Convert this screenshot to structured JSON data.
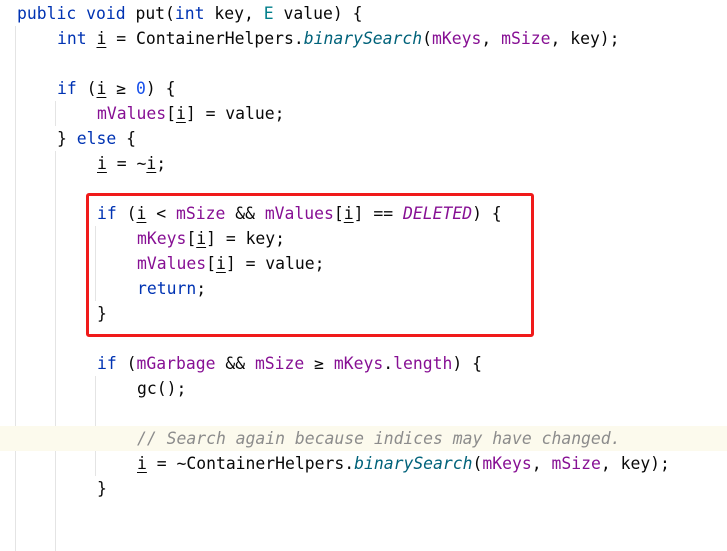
{
  "editor": {
    "language": "Java",
    "lines": [
      {
        "indent": 0,
        "tokens": [
          {
            "t": "public",
            "c": "kw"
          },
          {
            "t": " "
          },
          {
            "t": "void",
            "c": "kw"
          },
          {
            "t": " put("
          },
          {
            "t": "int",
            "c": "kw"
          },
          {
            "t": " key, "
          },
          {
            "t": "E",
            "c": "type-param"
          },
          {
            "t": " value) {"
          }
        ]
      },
      {
        "indent": 1,
        "tokens": [
          {
            "t": "int",
            "c": "kw"
          },
          {
            "t": " "
          },
          {
            "t": "i",
            "c": "reassigned"
          },
          {
            "t": " = ContainerHelpers."
          },
          {
            "t": "binarySearch",
            "c": "static-method"
          },
          {
            "t": "("
          },
          {
            "t": "mKeys",
            "c": "field"
          },
          {
            "t": ", "
          },
          {
            "t": "mSize",
            "c": "field"
          },
          {
            "t": ", key);"
          }
        ]
      },
      {
        "indent": 0,
        "tokens": []
      },
      {
        "indent": 1,
        "tokens": [
          {
            "t": "if",
            "c": "kw"
          },
          {
            "t": " ("
          },
          {
            "t": "i",
            "c": "reassigned"
          },
          {
            "t": " ≥ "
          },
          {
            "t": "0",
            "c": "num"
          },
          {
            "t": ") {"
          }
        ]
      },
      {
        "indent": 2,
        "tokens": [
          {
            "t": "mValues",
            "c": "field"
          },
          {
            "t": "["
          },
          {
            "t": "i",
            "c": "reassigned"
          },
          {
            "t": "] = value;"
          }
        ]
      },
      {
        "indent": 1,
        "tokens": [
          {
            "t": "} "
          },
          {
            "t": "else",
            "c": "kw"
          },
          {
            "t": " {"
          }
        ]
      },
      {
        "indent": 2,
        "tokens": [
          {
            "t": "i",
            "c": "reassigned"
          },
          {
            "t": " = ~"
          },
          {
            "t": "i",
            "c": "reassigned"
          },
          {
            "t": ";"
          }
        ]
      },
      {
        "indent": 0,
        "tokens": []
      },
      {
        "indent": 2,
        "tokens": [
          {
            "t": "if",
            "c": "kw"
          },
          {
            "t": " ("
          },
          {
            "t": "i",
            "c": "reassigned"
          },
          {
            "t": " < "
          },
          {
            "t": "mSize",
            "c": "field"
          },
          {
            "t": " && "
          },
          {
            "t": "mValues",
            "c": "field"
          },
          {
            "t": "["
          },
          {
            "t": "i",
            "c": "reassigned"
          },
          {
            "t": "] == "
          },
          {
            "t": "DELETED",
            "c": "const"
          },
          {
            "t": ") {"
          }
        ]
      },
      {
        "indent": 3,
        "tokens": [
          {
            "t": "mKeys",
            "c": "field"
          },
          {
            "t": "["
          },
          {
            "t": "i",
            "c": "reassigned"
          },
          {
            "t": "] = key;"
          }
        ]
      },
      {
        "indent": 3,
        "tokens": [
          {
            "t": "mValues",
            "c": "field"
          },
          {
            "t": "["
          },
          {
            "t": "i",
            "c": "reassigned"
          },
          {
            "t": "] = value;"
          }
        ]
      },
      {
        "indent": 3,
        "tokens": [
          {
            "t": "return",
            "c": "kw"
          },
          {
            "t": ";"
          }
        ]
      },
      {
        "indent": 2,
        "tokens": [
          {
            "t": "}"
          }
        ]
      },
      {
        "indent": 0,
        "tokens": []
      },
      {
        "indent": 2,
        "tokens": [
          {
            "t": "if",
            "c": "kw"
          },
          {
            "t": " ("
          },
          {
            "t": "mGarbage",
            "c": "field"
          },
          {
            "t": " && "
          },
          {
            "t": "mSize",
            "c": "field"
          },
          {
            "t": " ≥ "
          },
          {
            "t": "mKeys",
            "c": "field"
          },
          {
            "t": "."
          },
          {
            "t": "length",
            "c": "field"
          },
          {
            "t": ") {"
          }
        ]
      },
      {
        "indent": 3,
        "tokens": [
          {
            "t": "gc();"
          }
        ]
      },
      {
        "indent": 0,
        "tokens": []
      },
      {
        "indent": 3,
        "current": true,
        "tokens": [
          {
            "t": "// Search again because indices may have changed.",
            "c": "comment"
          }
        ]
      },
      {
        "indent": 3,
        "tokens": [
          {
            "t": "i",
            "c": "reassigned"
          },
          {
            "t": " = ~ContainerHelpers."
          },
          {
            "t": "binarySearch",
            "c": "static-method"
          },
          {
            "t": "("
          },
          {
            "t": "mKeys",
            "c": "field"
          },
          {
            "t": ", "
          },
          {
            "t": "mSize",
            "c": "field"
          },
          {
            "t": ", key);"
          }
        ]
      },
      {
        "indent": 2,
        "tokens": [
          {
            "t": "}"
          }
        ]
      }
    ],
    "highlight_box": {
      "label": "red-annotation",
      "color": "#f01a1a",
      "from_line": 8,
      "to_line": 12
    }
  }
}
